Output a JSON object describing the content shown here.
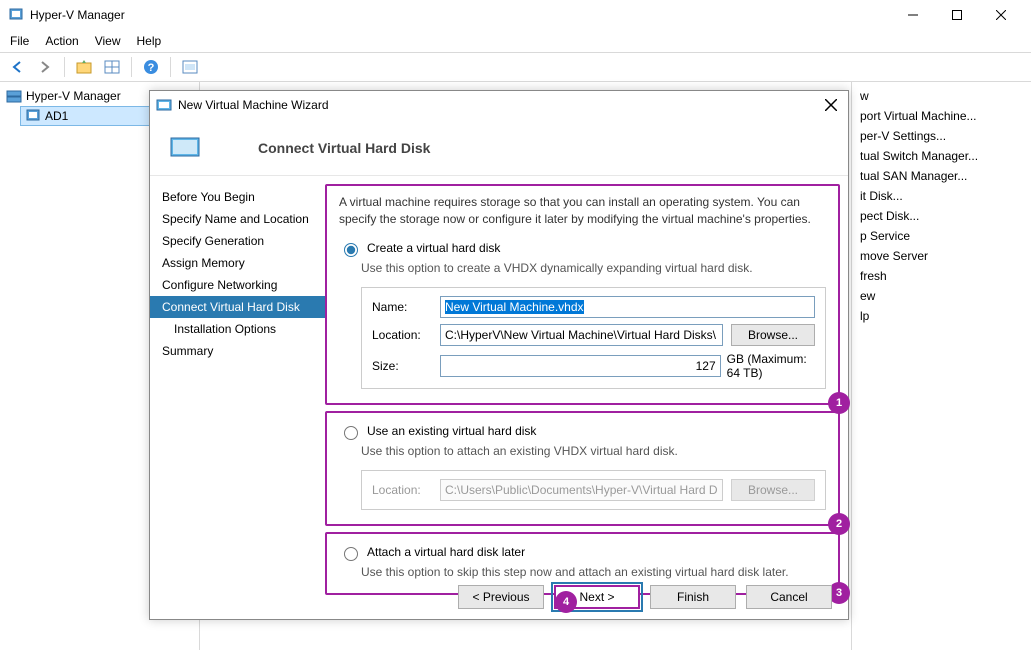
{
  "app": {
    "title": "Hyper-V Manager"
  },
  "menu": [
    "File",
    "Action",
    "View",
    "Help"
  ],
  "tree": {
    "root": "Hyper-V Manager",
    "child": "AD1"
  },
  "actions": {
    "items": [
      "w",
      "port Virtual Machine...",
      "per-V Settings...",
      "tual Switch Manager...",
      "tual SAN Manager...",
      "it Disk...",
      "pect Disk...",
      "p Service",
      "move Server",
      "fresh",
      "ew",
      "lp"
    ]
  },
  "dialog": {
    "title": "New Virtual Machine Wizard",
    "heading": "Connect Virtual Hard Disk",
    "steps": [
      "Before You Begin",
      "Specify Name and Location",
      "Specify Generation",
      "Assign Memory",
      "Configure Networking",
      "Connect Virtual Hard Disk",
      "Installation Options",
      "Summary"
    ],
    "active_step": 5,
    "hint": "A virtual machine requires storage so that you can install an operating system. You can specify the storage now or configure it later by modifying the virtual machine's properties.",
    "opt1": {
      "label": "Create a virtual hard disk",
      "desc": "Use this option to create a VHDX dynamically expanding virtual hard disk.",
      "name_label": "Name:",
      "name_value": "New Virtual Machine.vhdx",
      "loc_label": "Location:",
      "loc_value": "C:\\HyperV\\New Virtual Machine\\Virtual Hard Disks\\",
      "size_label": "Size:",
      "size_value": "127",
      "size_suffix": "GB (Maximum: 64 TB)",
      "browse": "Browse..."
    },
    "opt2": {
      "label": "Use an existing virtual hard disk",
      "desc": "Use this option to attach an existing VHDX virtual hard disk.",
      "loc_label": "Location:",
      "loc_value": "C:\\Users\\Public\\Documents\\Hyper-V\\Virtual Hard Disks\\",
      "browse": "Browse..."
    },
    "opt3": {
      "label": "Attach a virtual hard disk later",
      "desc": "Use this option to skip this step now and attach an existing virtual hard disk later."
    },
    "buttons": {
      "prev": "< Previous",
      "next": "Next >",
      "finish": "Finish",
      "cancel": "Cancel"
    },
    "annot": [
      "1",
      "2",
      "3",
      "4"
    ]
  }
}
